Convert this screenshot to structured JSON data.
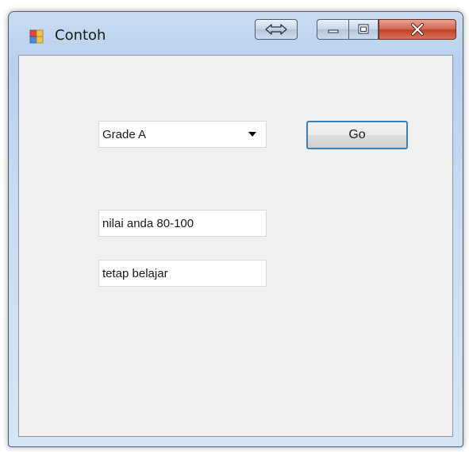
{
  "window": {
    "title": "Contoh",
    "icon": "form-app-icon",
    "caption_buttons": {
      "swap": "double-arrow-icon",
      "minimize": "minimize-icon",
      "maximize": "maximize-icon",
      "close": "close-icon"
    }
  },
  "form": {
    "grade_combo": {
      "selected": "Grade A"
    },
    "go_button": {
      "label": "Go"
    },
    "score_textbox": {
      "value": "nilai anda 80-100"
    },
    "message_textbox": {
      "value": "tetap belajar"
    }
  },
  "colors": {
    "client_background": "#f0f0f0",
    "close_button": "#c24128",
    "focus_border": "#3c7fb1"
  }
}
